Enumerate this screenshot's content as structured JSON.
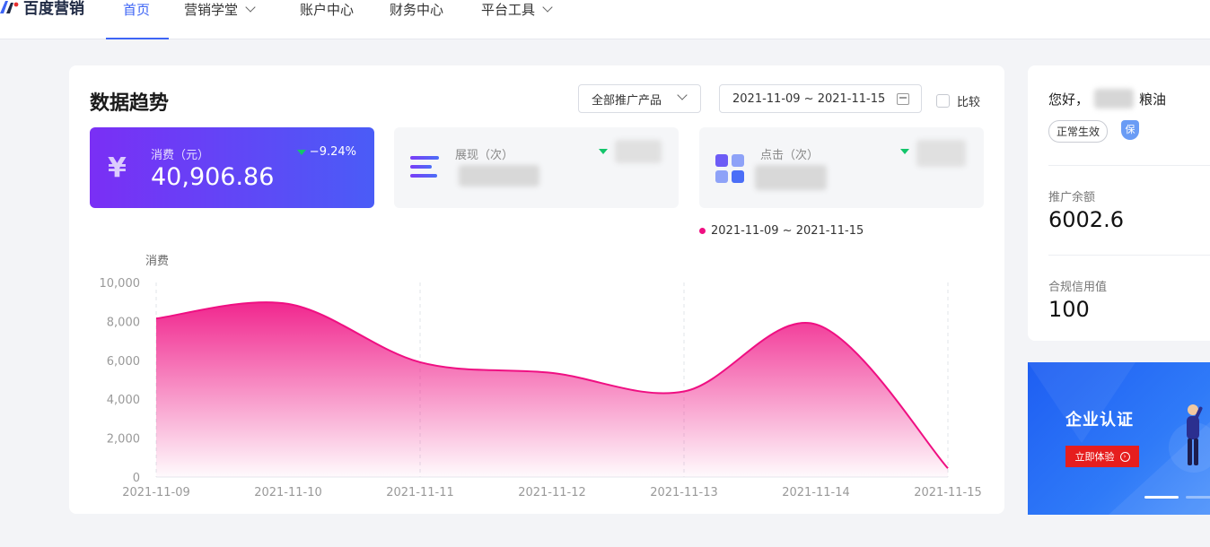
{
  "nav": {
    "logo_text": "百度营销",
    "items": [
      {
        "label": "首页",
        "active": true,
        "dropdown": false
      },
      {
        "label": "营销学堂",
        "active": false,
        "dropdown": true
      },
      {
        "label": "账户中心",
        "active": false,
        "dropdown": false
      },
      {
        "label": "财务中心",
        "active": false,
        "dropdown": false
      },
      {
        "label": "平台工具",
        "active": false,
        "dropdown": true
      }
    ]
  },
  "trend": {
    "title": "数据趋势",
    "product_select": "全部推广产品",
    "date_range": "2021-11-09 ~ 2021-11-15",
    "compare_label": "比较",
    "metrics": [
      {
        "label": "消费（元）",
        "value": "40,906.86",
        "change": "−9.24%",
        "icon": "yuan-icon"
      },
      {
        "label": "展现（次）",
        "value": "",
        "change": "",
        "icon": "bar-lines-icon"
      },
      {
        "label": "点击（次）",
        "value": "",
        "change": "",
        "icon": "click-grid-icon"
      }
    ],
    "legend_label": "2021-11-09 ~ 2021-11-15"
  },
  "chart_data": {
    "type": "area",
    "ylabel": "消费",
    "xlabel": "",
    "x": [
      "2021-11-09",
      "2021-11-10",
      "2021-11-11",
      "2021-11-12",
      "2021-11-13",
      "2021-11-14",
      "2021-11-15"
    ],
    "series": [
      {
        "name": "2021-11-09 ~ 2021-11-15",
        "values": [
          8150,
          8900,
          5900,
          5350,
          4400,
          7850,
          450
        ]
      }
    ],
    "y_ticks": [
      "0",
      "2,000",
      "4,000",
      "6,000",
      "8,000",
      "10,000"
    ],
    "ylim": [
      0,
      10000
    ],
    "grid": "vertical dashed",
    "legend_position": "top-right",
    "color": "#ef0f82"
  },
  "account": {
    "greeting": "您好，",
    "name_suffix": "粮油",
    "status": "正常生效",
    "shield_label": "保",
    "balance_label": "推广余额",
    "balance_value": "6002.6",
    "credit_label": "合规信用值",
    "credit_value": "100"
  },
  "banner": {
    "title": "企业认证",
    "button_label": "立即体验"
  },
  "colors": {
    "accent": "#3d64f5",
    "chart_pink": "#ef0f82",
    "down_green": "#13c56b"
  }
}
